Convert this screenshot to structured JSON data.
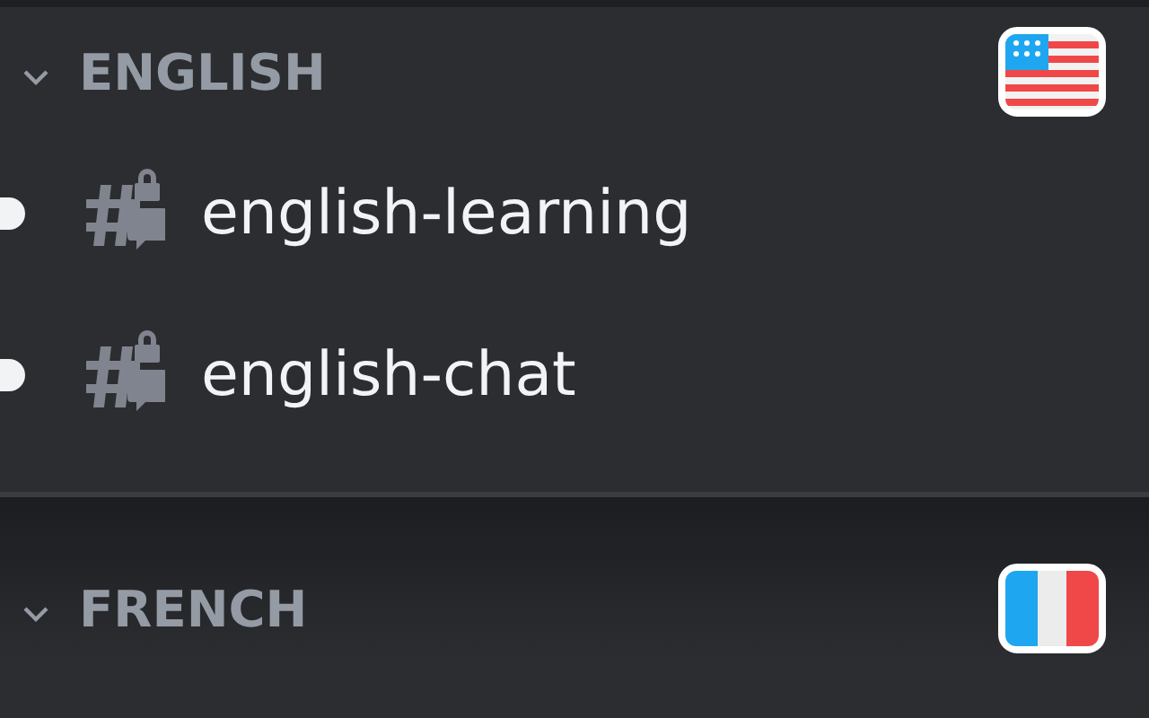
{
  "categories": [
    {
      "name": "ENGLISH",
      "expanded": true,
      "flag": {
        "kind": "us"
      },
      "channels": [
        {
          "name": "english-learning",
          "unread": true
        },
        {
          "name": "english-chat",
          "unread": true
        }
      ]
    },
    {
      "name": "FRENCH",
      "expanded": true,
      "flag": {
        "kind": "fr"
      }
    }
  ]
}
